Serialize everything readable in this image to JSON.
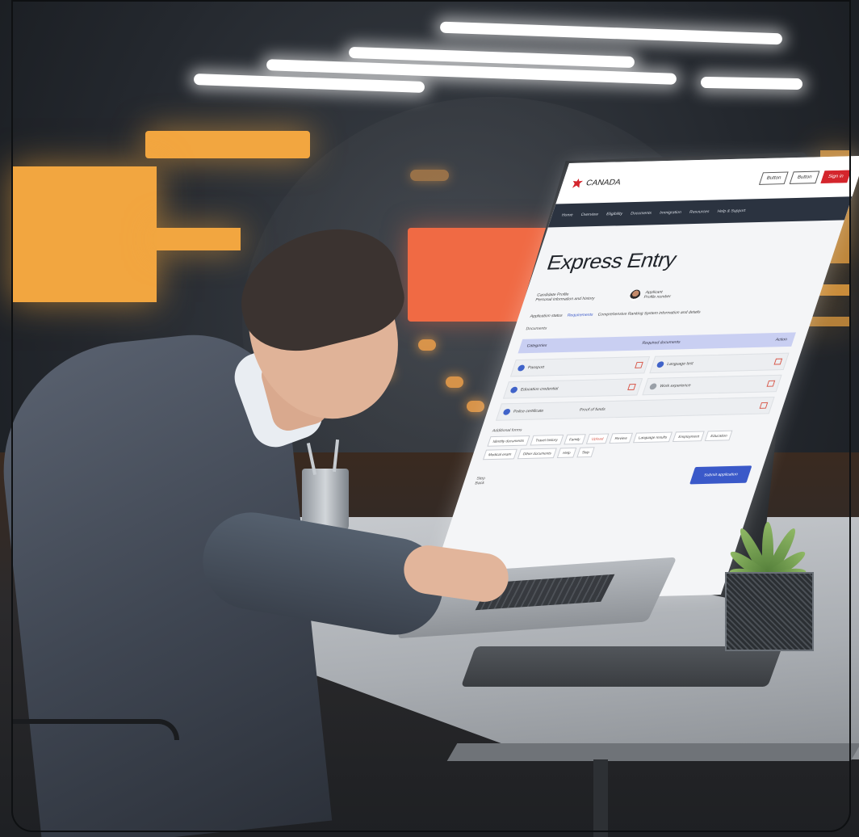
{
  "screen": {
    "brand": "CANADA",
    "header_buttons": [
      "Button",
      "Button",
      "Sign in"
    ],
    "nav_items": [
      "Home",
      "Overview",
      "Eligibility",
      "Documents",
      "Immigration",
      "Resources",
      "Help & Support"
    ],
    "title": "Express Entry",
    "profile": {
      "line1": "Candidate Profile",
      "line2": "Personal information and history",
      "user_name": "Applicant",
      "user_meta": "Profile number"
    },
    "section_row": {
      "left": "Application status",
      "middle": "Requirements",
      "right": "Comprehensive Ranking System information and details"
    },
    "sub_label": "Documents",
    "strip": {
      "left": "Categories",
      "middle": "Required documents",
      "right": "Action"
    },
    "cards": [
      "Passport",
      "Language test",
      "Education credential",
      "Work experience",
      "Police certificate",
      "Proof of funds"
    ],
    "list_label": "Additional forms",
    "chips": [
      "Identity documents",
      "Travel history",
      "Family",
      "Upload",
      "Review",
      "Language results",
      "Employment",
      "Education",
      "Medical exam",
      "Other documents",
      "Help",
      "Skip"
    ],
    "footer_left": "Step",
    "footer_left2": "Back",
    "submit_label": "Submit application"
  }
}
